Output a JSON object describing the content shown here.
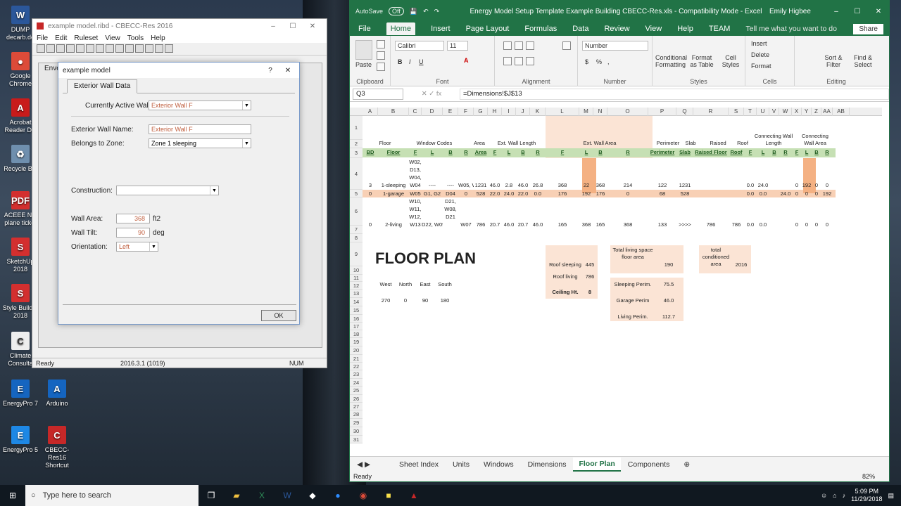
{
  "desktop": {
    "icons": [
      {
        "label": "DUMP decarb.do",
        "color": "#2b579a",
        "glyph": "W"
      },
      {
        "label": "Google Chrome",
        "color": "#dd4b39",
        "glyph": "●"
      },
      {
        "label": "Acrobat Reader DC",
        "color": "#c81b1b",
        "glyph": "A"
      },
      {
        "label": "Recycle Bin",
        "color": "#6f8fae",
        "glyph": "♻"
      },
      {
        "label": "ACEEE NO plane ticket",
        "color": "#d32f2f",
        "glyph": "PDF"
      },
      {
        "label": "SketchUp 2018",
        "color": "#d32f2f",
        "glyph": "S"
      },
      {
        "label": "Style Builder 2018",
        "color": "#d32f2f",
        "glyph": "S"
      },
      {
        "label": "Climate Consulta",
        "color": "#eeeeee",
        "glyph": "C"
      },
      {
        "label": "EnergyPro 7",
        "color": "#1565c0",
        "glyph": "E"
      },
      {
        "label": "Arduino",
        "color": "#1565c0",
        "glyph": "A"
      },
      {
        "label": "EnergyPro 5",
        "color": "#1e88e5",
        "glyph": "E"
      },
      {
        "label": "CBECC-Res16 Shortcut",
        "color": "#c62828",
        "glyph": "C"
      }
    ]
  },
  "cbecc": {
    "title": "example model.ribd - CBECC-Res 2016",
    "menu": [
      "File",
      "Edit",
      "Ruleset",
      "View",
      "Tools",
      "Help"
    ],
    "behind_label": "Enve",
    "status_ready": "Ready",
    "status_version": "2016.3.1 (1019)",
    "status_num": "NUM"
  },
  "dialog": {
    "title": "example model",
    "help": "?",
    "close": "✕",
    "tab": "Exterior Wall Data",
    "active_wall_label": "Currently Active Wall:",
    "active_wall_value": "Exterior Wall F",
    "name_label": "Exterior Wall Name:",
    "name_value": "Exterior Wall F",
    "zone_label": "Belongs to Zone:",
    "zone_value": "Zone 1 sleeping",
    "construction_label": "Construction:",
    "construction_value": "",
    "area_label": "Wall Area:",
    "area_value": "368",
    "area_unit": "ft2",
    "tilt_label": "Wall Tilt:",
    "tilt_value": "90",
    "tilt_unit": "deg",
    "orient_label": "Orientation:",
    "orient_value": "Left",
    "ok": "OK"
  },
  "excel": {
    "autosave": "AutoSave",
    "autosave_state": "Off",
    "title": "Energy Model Setup Template Example Building CBECC-Res.xls - Compatibility Mode - Excel",
    "user": "Emily Higbee",
    "tabs": [
      "File",
      "Home",
      "Insert",
      "Page Layout",
      "Formulas",
      "Data",
      "Review",
      "View",
      "Help",
      "TEAM"
    ],
    "tell": "Tell me what you want to do",
    "share": "Share",
    "ribbon": {
      "clipboard": "Clipboard",
      "paste": "Paste",
      "font": "Font",
      "font_name": "Calibri",
      "font_size": "11",
      "alignment": "Alignment",
      "number": "Number",
      "number_format": "Number",
      "styles": "Styles",
      "cond": "Conditional Formatting",
      "fmt_table": "Format as Table",
      "cell_styles": "Cell Styles",
      "cells": "Cells",
      "insert": "Insert",
      "delete": "Delete",
      "format": "Format",
      "editing": "Editing",
      "sort": "Sort & Filter",
      "find": "Find & Select"
    },
    "namebox": "Q3",
    "formula": "=Dimensions!$J$13",
    "columns": [
      "A",
      "B",
      "C",
      "D",
      "E",
      "F",
      "G",
      "H",
      "I",
      "J",
      "K",
      "L",
      "M",
      "N",
      "O",
      "P",
      "Q",
      "R",
      "S",
      "T",
      "U",
      "V",
      "W",
      "X",
      "Y",
      "Z",
      "AA",
      "AB"
    ],
    "rows": [
      "1",
      "2",
      "3",
      "4",
      "5",
      "6",
      "7",
      "8",
      "9",
      "10",
      "11",
      "12",
      "13",
      "14",
      "15",
      "16",
      "17",
      "18",
      "19",
      "20",
      "21",
      "22",
      "23",
      "24",
      "25",
      "26",
      "27",
      "28",
      "29",
      "30",
      "31"
    ],
    "head1": {
      "floor": "Floor",
      "window_codes": "Window Codes",
      "area": "Area",
      "ext_len": "Ext. Wall Length",
      "ext_area": "Ext. Wall Area",
      "perimeter": "Perimeter",
      "slab": "Slab",
      "raised": "Raised",
      "roof": "Roof",
      "conn_len": "Connecting Wall Length",
      "conn_area": "Connecting Wall Area"
    },
    "head2": [
      "BD",
      "Floor",
      "F",
      "L",
      "B",
      "R",
      "Area",
      "F",
      "L",
      "B",
      "R",
      "F",
      "L",
      "B",
      "R",
      "Perimeter",
      "Slab",
      "Raised Floor",
      "Roof",
      "F",
      "L",
      "B",
      "R",
      "F",
      "L",
      "B",
      "R"
    ],
    "r3": {
      "bd": "3",
      "floor": "1-sleeping",
      "c": "W02, D13, W04, W04",
      "d": "----",
      "e": "----",
      "f": "W05, W05",
      "g": "1231",
      "h": "46.0",
      "i": "2.8",
      "j": "46.0",
      "k": "26.8",
      "l": "368",
      "m": "22",
      "n": "368",
      "o": "214",
      "p": "122",
      "q": "1231",
      "t": "0.0",
      "u": "24.0",
      "x": "0",
      "y": "192",
      "z": "0",
      "aa": "0"
    },
    "r4": {
      "bd": "0",
      "floor": "1-garage",
      "c": "W05",
      "d": "G1, G2",
      "e": "D04",
      "f": "0",
      "g": "528",
      "h": "22.0",
      "i": "24.0",
      "j": "22.0",
      "k": "0.0",
      "l": "176",
      "m": "192",
      "n": "176",
      "o": "0",
      "p": "68",
      "q": "528",
      "t": "0.0",
      "u": "0.0",
      "w": "24.0",
      "x": "0",
      "y": "0",
      "z": "0",
      "aa": "192"
    },
    "r5": {
      "bd": "0",
      "floor": "2-living",
      "c": "W10, W11, W12, W13",
      "d": "D22, W09",
      "e": "D21, W08, D21",
      "f": "W07",
      "g": "786",
      "h": "20.7",
      "i": "46.0",
      "j": "20.7",
      "k": "46.0",
      "l": "165",
      "m": "368",
      "n": "165",
      "o": "368",
      "p": "133",
      "q": ">>>>",
      "r": "786",
      "s": "786",
      "t": "0.0",
      "u": "0.0",
      "x": "0",
      "y": "0",
      "z": "0",
      "aa": "0"
    },
    "floorplan": "FLOOR PLAN",
    "dirs": [
      "West",
      "North",
      "East",
      "South"
    ],
    "dir_vals": [
      "270",
      "0",
      "90",
      "180"
    ],
    "roof_sleeping": "Roof sleeping",
    "roof_sleeping_v": "445",
    "roof_living": "Roof living",
    "roof_living_v": "786",
    "ceiling": "Ceiling Ht.",
    "ceiling_v": "8",
    "total_living": "Total living space floor area",
    "total_living_v": "190",
    "total_cond": "total conditioned area",
    "total_cond_v": "2016",
    "sleep_perim": "Sleeping Perim.",
    "sleep_perim_v": "75.5",
    "garage_perim": "Garage Perim",
    "garage_perim_v": "46.0",
    "living_perim": "Living Perim.",
    "living_perim_v": "112.7",
    "sheets": [
      "Sheet Index",
      "Units",
      "Windows",
      "Dimensions",
      "Floor Plan",
      "Components"
    ],
    "active_sheet": "Floor Plan",
    "status": "Ready",
    "zoom": "82%"
  },
  "taskbar": {
    "search": "Type here to search",
    "time": "5:09 PM",
    "date": "11/29/2018"
  }
}
